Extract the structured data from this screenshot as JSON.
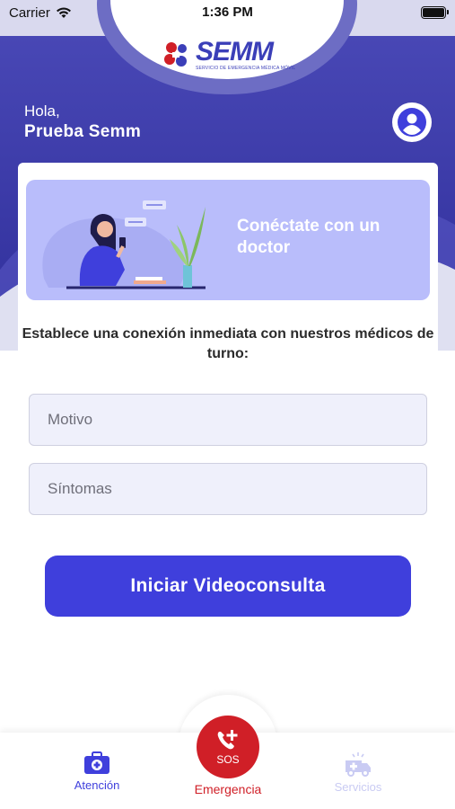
{
  "status_bar": {
    "carrier": "Carrier",
    "time": "1:36 PM"
  },
  "logo": {
    "word": "SEMM",
    "tagline": "SERVICIO DE EMERGENCIA MÉDICA MÓVIL"
  },
  "greeting": {
    "hello": "Hola,",
    "name": "Prueba Semm"
  },
  "banner": {
    "title": "Conéctate con un doctor"
  },
  "description": "Establece una conexión inmediata con nuestros médicos de turno:",
  "form": {
    "motivo_placeholder": "Motivo",
    "sintomas_placeholder": "Síntomas",
    "submit_label": "Iniciar Videoconsulta"
  },
  "bottom_nav": {
    "atencion": "Atención",
    "sos": "SOS",
    "emergencia": "Emergencia",
    "servicios": "Servicios"
  },
  "colors": {
    "primary": "#3f3fdc",
    "header": "#3b3ab0",
    "banner": "#b9bdfb",
    "emergency": "#d01f27",
    "disabled": "#c9cbf3"
  },
  "icons": {
    "wifi": "wifi-icon",
    "battery": "battery-icon",
    "avatar": "user-avatar-icon",
    "atencion": "medical-kit-icon",
    "sos": "phone-plus-icon",
    "servicios": "ambulance-icon"
  }
}
